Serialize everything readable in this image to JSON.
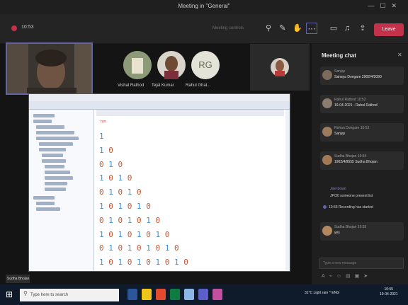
{
  "window": {
    "title": "Meeting in \"General\"",
    "controls": [
      "—",
      "☐",
      "✕"
    ]
  },
  "meeting": {
    "timer": "10:53",
    "dimmed_label": "Meeting controls",
    "leave_label": "Leave"
  },
  "toolbar_icons": [
    "people-icon",
    "chat-icon",
    "raise-hand-icon",
    "more-icon",
    "camera-icon",
    "mic-icon",
    "share-icon"
  ],
  "participants": [
    {
      "name": "Vishal Rathod",
      "initials": ""
    },
    {
      "name": "Tejal Kumar",
      "initials": ""
    },
    {
      "name": "Rahul Ghat...",
      "initials": "RG"
    }
  ],
  "self_view_label": "Sudha Bhojan",
  "chat": {
    "title": "Meeting chat",
    "messages": [
      {
        "name": "Sanjay",
        "text": "Sahaya Dongare 2902/4/2090"
      },
      {
        "name": "Rahul Rathod  10:52",
        "text": "19-04-2021 - Rahul Rathod"
      },
      {
        "name": "Rohan Dongare  10:53",
        "text": "Sanjay"
      },
      {
        "name": "Sudha Bhojan  10:54",
        "text": "1902/4/9555 Sudha Bhojan"
      }
    ],
    "system_line": "Joel down",
    "system_msg": "JP/20 someone present list",
    "recording_note": "10:55  Recording has started",
    "last_msg": {
      "name": "Sudha Bhojan  10:55",
      "text": "yes"
    },
    "compose_placeholder": "Type a new message",
    "compose_icons": [
      "format-icon",
      "attach-icon",
      "emoji-icon",
      "gif-icon",
      "sticker-icon",
      "send-icon"
    ]
  },
  "ide": {
    "output_line": "run:",
    "pattern_lines": [
      "1",
      "1 0",
      "0 1 0",
      "1 0 1 0",
      "0 1 0 1 0",
      "1 0 1 0 1 0",
      "0 1 0 1 0 1 0",
      "1 0 1 0 1 0 1 0",
      "0 1 0 1 0 1 0 1 0",
      "1 0 1 0 1 0 1 0 1 0"
    ]
  },
  "taskbar": {
    "search_placeholder": "Type here to search",
    "tray_text": "31°C  Light rain  ^  ENG",
    "time": "10:55",
    "date": "19-04-2021",
    "app_colors": [
      "#2b579a",
      "#f0c419",
      "#e24a2e",
      "#0f7b41",
      "#8bb6e8",
      "#5b5fc7",
      "#c24f9f"
    ]
  }
}
